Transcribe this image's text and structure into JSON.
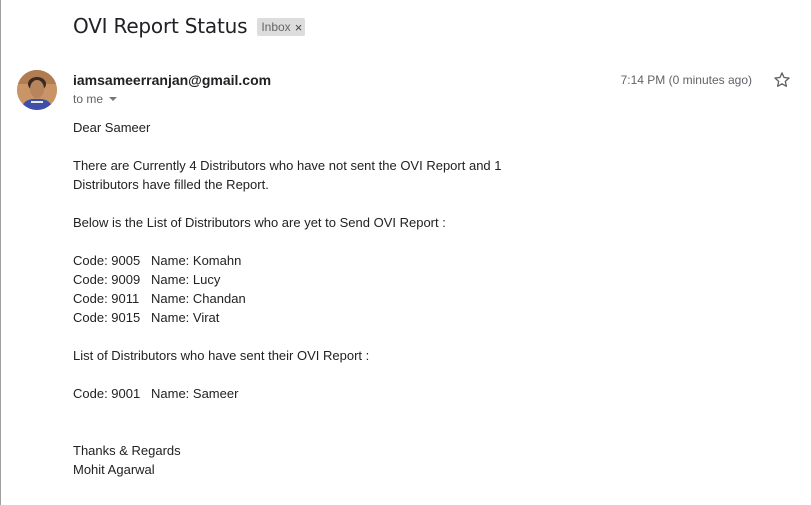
{
  "email": {
    "subject": "OVI Report Status",
    "label": "Inbox",
    "sender": "iamsameerranjan@gmail.com",
    "recipient": "to me",
    "time": "7:14 PM (0 minutes ago)",
    "greeting": "Dear Sameer",
    "intro_line1": "There are Currently 4 Distributors who have not sent the OVI Report and 1",
    "intro_line2": "Distributors have filled the Report.",
    "pending_heading": "Below is the List of Distributors who are yet to Send OVI Report :",
    "pending": [
      {
        "code": "Code: 9005",
        "name": "Name: Komahn"
      },
      {
        "code": "Code: 9009",
        "name": "Name: Lucy"
      },
      {
        "code": "Code: 9011",
        "name": "Name: Chandan"
      },
      {
        "code": "Code: 9015",
        "name": "Name: Virat"
      }
    ],
    "sent_heading": "List of Distributors who have sent their OVI Report :",
    "sent": [
      {
        "code": "Code: 9001",
        "name": "Name: Sameer"
      }
    ],
    "closing": "Thanks & Regards",
    "signature": "Mohit Agarwal"
  },
  "icons": {
    "label_close": "close-icon",
    "star": "star-icon",
    "avatar": "avatar",
    "caret": "chevron-down-icon"
  },
  "colors": {
    "label_bg": "#dddddd",
    "text": "#222222",
    "muted": "#5f6368"
  }
}
